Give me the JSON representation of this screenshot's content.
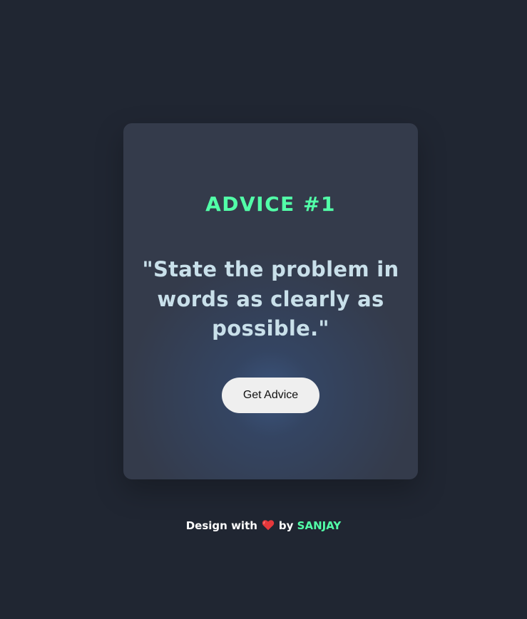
{
  "card": {
    "title": "ADVICE #1",
    "advice": "\"State the problem in words as clearly as possible.\"",
    "button_label": "Get Advice"
  },
  "footer": {
    "prefix": "Design with",
    "heart_icon": "heart-icon",
    "by": "by",
    "author": "SANJAY"
  },
  "colors": {
    "background": "#202632",
    "card": "#343b4b",
    "accent": "#52ffa8",
    "advice_text": "#c9e0ea",
    "button": "#efefef",
    "heart": "#e5383b"
  }
}
